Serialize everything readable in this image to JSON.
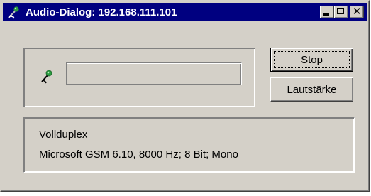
{
  "window": {
    "title": "Audio-Dialog: 192.168.111.101",
    "icon": "microphone-icon",
    "controls": {
      "minimize_icon": "minimize-icon",
      "maximize_icon": "maximize-icon",
      "close_icon": "close-icon",
      "close_glyph": "✕"
    },
    "title_bar_color": "#000080",
    "face_color": "#d4d0c8"
  },
  "audio": {
    "microphone_icon": "microphone-icon",
    "input_level": 0
  },
  "buttons": {
    "stop_label": "Stop",
    "volume_label": "Lautstärke"
  },
  "info": {
    "mode": "Vollduplex",
    "codec": "Microsoft GSM 6.10, 8000 Hz; 8 Bit; Mono"
  }
}
